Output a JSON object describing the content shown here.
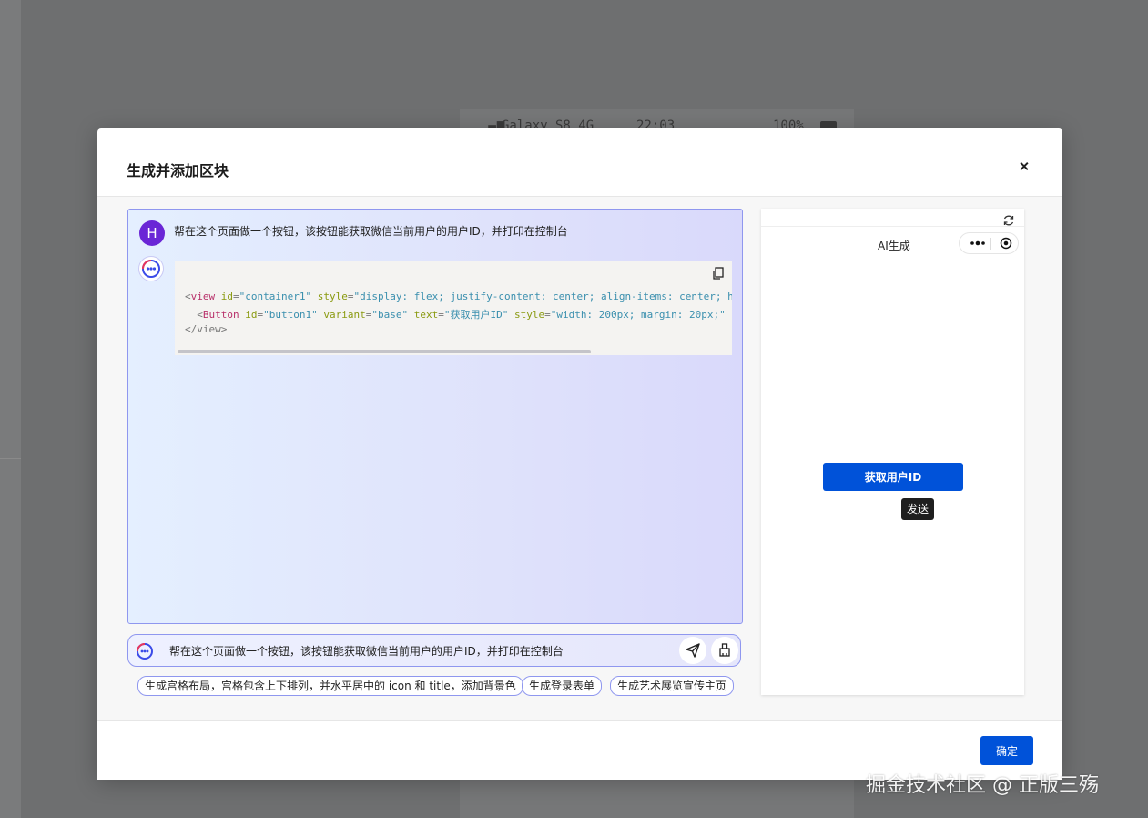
{
  "background": {
    "status_bar": {
      "device": "Galaxy S8",
      "network": "4G",
      "time": "22:03",
      "battery": "100%"
    }
  },
  "modal": {
    "title": "生成并添加区块",
    "confirm_label": "确定"
  },
  "chat": {
    "user_avatar_letter": "H",
    "user_message": "帮在这个页面做一个按钮，该按钮能获取微信当前用户的用户ID，并打印在控制台",
    "code": {
      "line1_tag": "view",
      "line1_attr1": "id",
      "line1_val1": "\"container1\"",
      "line1_attr2": "style",
      "line1_val2": "\"display: flex; justify-content: center; align-items: center; h",
      "line2_tag": "Button",
      "line2_attr1": "id",
      "line2_val1": "\"button1\"",
      "line2_attr2": "variant",
      "line2_val2": "\"base\"",
      "line2_attr3": "text",
      "line2_val3": "\"获取用户ID\"",
      "line2_attr4": "style",
      "line2_val4": "\"width: 200px; margin: 20px;\"",
      "line3_close": "</view>"
    }
  },
  "input": {
    "value": "帮在这个页面做一个按钮，该按钮能获取微信当前用户的用户ID，并打印在控制台"
  },
  "suggestions": [
    "生成宫格布局，宫格包含上下排列，并水平居中的 icon 和 title，添加背景色",
    "生成登录表单",
    "生成艺术展览宣传主页"
  ],
  "preview": {
    "nav_title": "AI生成",
    "button_label": "获取用户ID",
    "tooltip": "发送"
  },
  "watermark": "掘金技术社区 @ 正版三殇",
  "colors": {
    "primary": "#0052d9",
    "accent_border": "#8f97ef",
    "user_avatar": "#6a26d6"
  }
}
